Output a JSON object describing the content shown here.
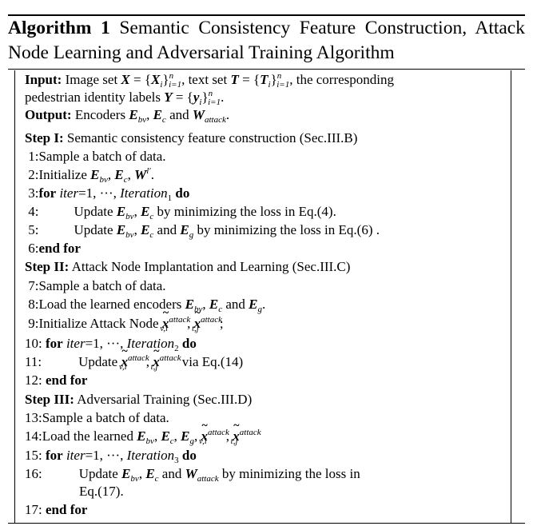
{
  "algorithm": {
    "label": "Algorithm 1",
    "title": "Semantic Consistency Feature Construction, Attack Node Learning and Adversarial Training Algorithm"
  },
  "input": {
    "label": "Input:",
    "text": "Image set X = {Xi}ni=1, text set T = {Ti}ni=1, the corresponding pedestrian identity labels Y = {yi}ni=1."
  },
  "output": {
    "label": "Output:",
    "text": "Encoders Ebv, Ec and Wattack."
  },
  "steps": [
    {
      "label": "Step I:",
      "title": "Semantic consistency feature construction (Sec.III.B)"
    },
    {
      "label": "Step II:",
      "title": "Attack Node Implantation and Learning (Sec.III.C)"
    },
    {
      "label": "Step III:",
      "title": "Adversarial Training (Sec.III.D)"
    }
  ],
  "lines": [
    "1:Sample a batch of data.",
    "2:Initialize Ebv, Ec, Wl'.",
    "3:for iter=1, ···, Iteration1 do",
    "4: Update Ebv, Ec by minimizing the loss in Eq.(4).",
    "5: Update Ebv, Ec and Eg by minimizing the loss in Eq.(6) .",
    "6:end for",
    "7:Sample a batch of data.",
    "8:Load the learned encoders Ebv, Ec and Eg.",
    "9:Initialize Attack Node x̃attackv,i, x̃attackt,j;",
    "10: for iter=1, ···, Iteration2 do",
    "11: Update x̃attackv,i, x̃attackt,j via Eq.(14)",
    "12: end for",
    "13:Sample a batch of data.",
    "14:Load the learned Ebv, Ec, Eg, x̃attackv,i, x̃attackt,j",
    "15: for iter=1, ···, Iteration3 do",
    "16: Update Ebv, Ec and Wattack by minimizing the loss in Eq.(17).",
    "17: end for"
  ],
  "tokens": {
    "X": "X",
    "T": "T",
    "Y": "Y",
    "Xi": "X",
    "Ti": "T",
    "yi": "y",
    "E": "E",
    "W": "W",
    "x": "x",
    "eq": " = {",
    "close": "}",
    "sub_i": "i",
    "sub_n_i1": "i=1",
    "sup_n": "n",
    "bv": "bv",
    "c": "c",
    "g": "g",
    "attack": "attack",
    "vi": "v,i",
    "tj": "t,j",
    "lp": "l′",
    "iter": "iter",
    "Iteration": "Iteration",
    "one": "1",
    "two": "2",
    "three": "3",
    "for": "for",
    "do": "do",
    "endfor": "end for",
    "dots": "···"
  }
}
